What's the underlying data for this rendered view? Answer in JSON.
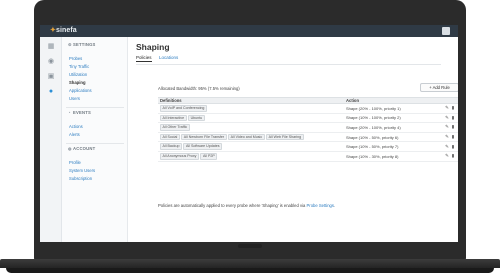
{
  "app": {
    "logo": "sinefa",
    "logo_mark": "✦"
  },
  "rail_icons": [
    "grid-icon",
    "globe-icon",
    "box-icon",
    "settings-icon"
  ],
  "sidebar": {
    "settings_title": "SETTINGS",
    "settings_items": [
      {
        "label": "Probes"
      },
      {
        "label": "Tiny Traffic"
      },
      {
        "label": "Utilization"
      },
      {
        "label": "Shaping"
      },
      {
        "label": "Applications"
      },
      {
        "label": "Users"
      }
    ],
    "events_title": "EVENTS",
    "events_items": [
      {
        "label": "Actions"
      },
      {
        "label": "Alerts"
      }
    ],
    "account_title": "ACCOUNT",
    "account_items": [
      {
        "label": "Profile"
      },
      {
        "label": "System Users"
      },
      {
        "label": "Subscription"
      }
    ]
  },
  "main": {
    "title": "Shaping",
    "tabs": [
      {
        "label": "Policies"
      },
      {
        "label": "Locations"
      }
    ],
    "bandwidth_text": "Allocated Bandwidth: 95% (7.5% remaining)",
    "add_rule_label": "+ Add Rule",
    "table": {
      "headers": [
        "Definitions",
        "Action"
      ],
      "rows": [
        {
          "tags": [
            "All VoIP and Conferencing"
          ],
          "action": "Shape (20% - 100%, priority 1)"
        },
        {
          "tags": [
            "All Interactive",
            "Ubuntu"
          ],
          "action": "Shape (10% - 100%, priority 2)"
        },
        {
          "tags": [
            "All Other Traffic"
          ],
          "action": "Shape (20% - 100%, priority 4)"
        },
        {
          "tags": [
            "All Social",
            "All Newborn File Transfer",
            "All Video and Music",
            "All Web File Sharing"
          ],
          "action": "Shape (10% - 50%, priority 6)"
        },
        {
          "tags": [
            "All Backup",
            "All Software Updates"
          ],
          "action": "Shape (10% - 50%, priority 7)"
        },
        {
          "tags": [
            "All Anonymous Proxy",
            "All P2P"
          ],
          "action": "Shape (10% - 30%, priority 8)"
        }
      ]
    },
    "footnote_prefix": "Policies are automatically applied to every probe where 'Shaping' is enabled via",
    "footnote_link": "Probe Settings",
    "footnote_suffix": "."
  },
  "colors": {
    "topbar": "#2f3a45",
    "link": "#2c7cc0",
    "accent": "#2c8fd6"
  }
}
